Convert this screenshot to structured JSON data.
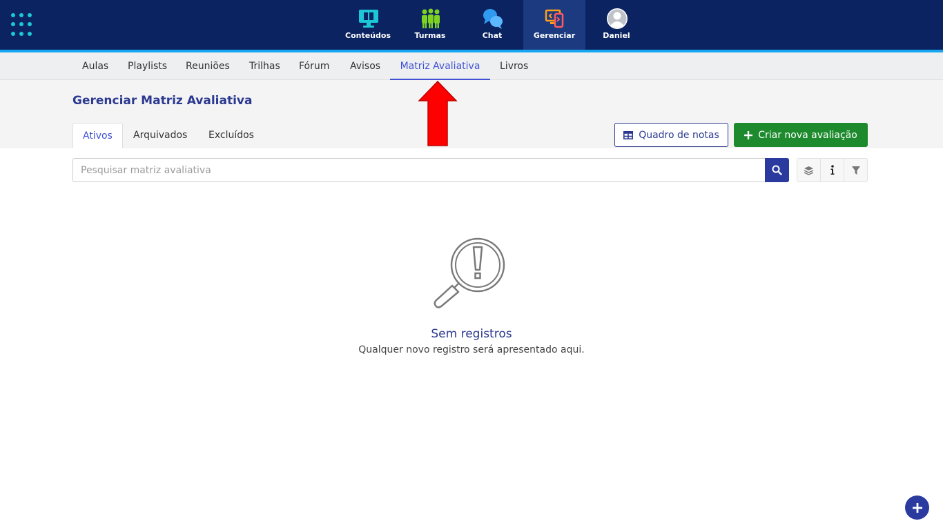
{
  "topnav": {
    "items": [
      {
        "label": "Conteúdos",
        "icon": "monitor-book-icon"
      },
      {
        "label": "Turmas",
        "icon": "people-icon"
      },
      {
        "label": "Chat",
        "icon": "chat-bubbles-icon"
      },
      {
        "label": "Gerenciar",
        "icon": "manage-devices-icon"
      },
      {
        "label": "Daniel",
        "icon": "avatar-icon"
      }
    ],
    "active": "Gerenciar"
  },
  "subnav": {
    "items": [
      "Aulas",
      "Playlists",
      "Reuniões",
      "Trilhas",
      "Fórum",
      "Avisos",
      "Matriz Avaliativa",
      "Livros"
    ],
    "active": "Matriz Avaliativa"
  },
  "page": {
    "title": "Gerenciar Matriz Avaliativa",
    "tabs": [
      "Ativos",
      "Arquivados",
      "Excluídos"
    ],
    "active_tab": "Ativos",
    "quadro_label": "Quadro de notas",
    "criar_label": "Criar nova avaliação"
  },
  "search": {
    "placeholder": "Pesquisar matriz avaliativa",
    "value": ""
  },
  "empty": {
    "title": "Sem registros",
    "subtitle": "Qualquer novo registro será apresentado aqui."
  },
  "colors": {
    "topbar": "#0b2461",
    "accent": "#3f51d6",
    "primary": "#2b3990",
    "green": "#1e8a2e",
    "arrow": "#ff0000"
  }
}
